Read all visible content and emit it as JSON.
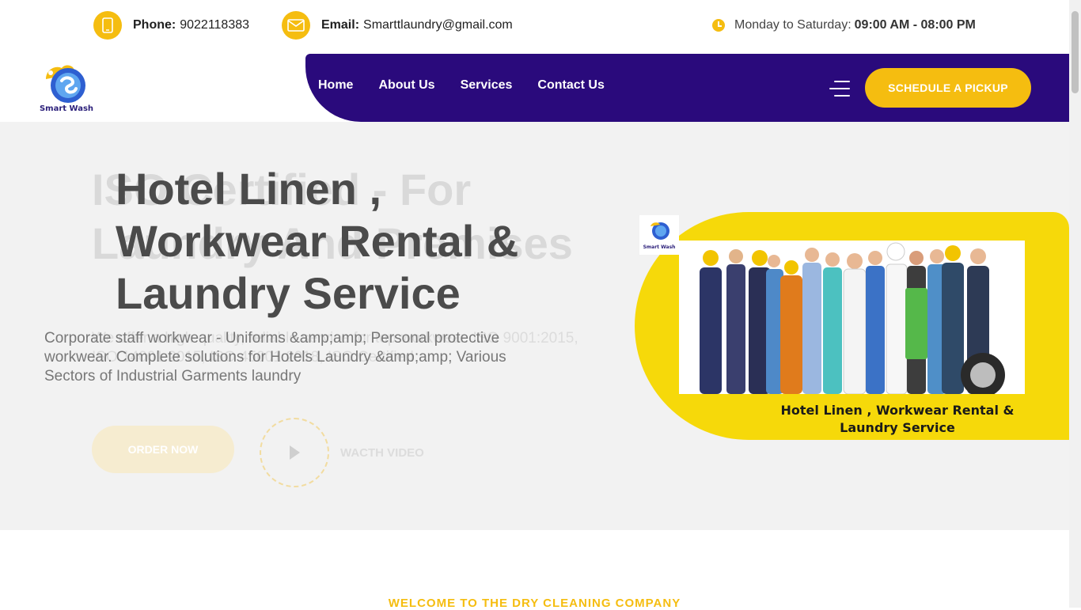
{
  "topbar": {
    "phone_label": "Phone:",
    "phone_value": "9022118383",
    "email_label": "Email:",
    "email_value": "Smarttlaundry@gmail.com",
    "hours_label": "Monday to Saturday:",
    "hours_value": "09:00 AM - 08:00 PM"
  },
  "brand": {
    "logo_text": "Smart Wash"
  },
  "nav": {
    "items": [
      "Home",
      "About Us",
      "Services",
      "Contact Us"
    ],
    "cta": "SCHEDULE A PICKUP"
  },
  "hero": {
    "ghost_title": "ISO Certified - For Laundry And Premises",
    "title": "Hotel Linen , Workwear Rental & Laundry Service",
    "ghost_desc": "We offer a high-quality, reliable service for top-workwear. ISO 9001:2015, ISO 14001:2015, ISO 45001:2018, ISO Certified",
    "description": "Corporate staff workwear - Uniforms &amp;amp; Personal protective workwear. Complete solutions for Hotels Laundry &amp;amp; Various Sectors of Industrial Garments laundry",
    "order_button": "ORDER NOW",
    "video_label": "WACTH VIDEO",
    "card_caption": "Hotel Linen , Workwear Rental & Laundry Service",
    "card_logo_text": "Smart Wash"
  },
  "section": {
    "welcome": "WELCOME TO THE DRY CLEANING COMPANY"
  },
  "colors": {
    "accent": "#f5bd10",
    "nav_bg": "#2a0a7c",
    "card_bg": "#f6d90a"
  }
}
